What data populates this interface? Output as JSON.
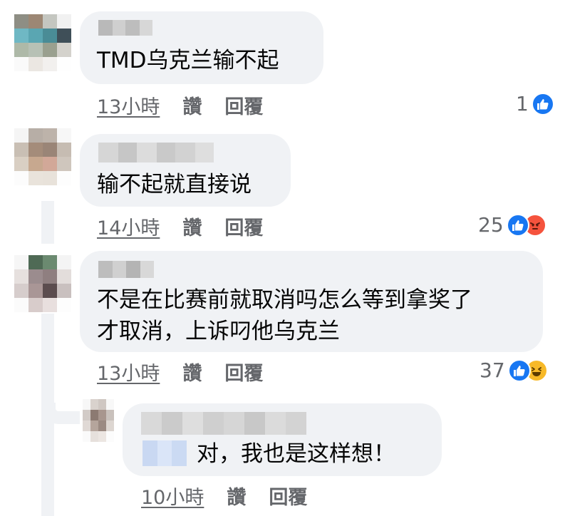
{
  "comments": [
    {
      "text_lines": [
        "TMD乌克兰输不起"
      ],
      "time": "13小時",
      "like_label": "讚",
      "reply_label": "回覆",
      "reaction_count": "1",
      "reactions": [
        "like-icon"
      ]
    },
    {
      "text_lines": [
        "输不起就直接说"
      ],
      "time": "14小時",
      "like_label": "讚",
      "reply_label": "回覆",
      "reaction_count": "25",
      "reactions": [
        "like-icon",
        "angry-icon"
      ]
    },
    {
      "text_lines": [
        "不是在比赛前就取消吗怎么等到拿奖了",
        "才取消，上诉叼他乌克兰"
      ],
      "time": "13小時",
      "like_label": "讚",
      "reply_label": "回覆",
      "reaction_count": "37",
      "reactions": [
        "like-icon",
        "haha-icon"
      ]
    }
  ],
  "reply": {
    "text": "对，我也是这样想！",
    "time": "10小時",
    "like_label": "讚",
    "reply_label": "回覆"
  },
  "colors": {
    "bubble": "#f0f2f5",
    "meta_text": "#65676b",
    "like": "#1877f2",
    "angry": "#f5533d",
    "haha": "#f7b928"
  }
}
